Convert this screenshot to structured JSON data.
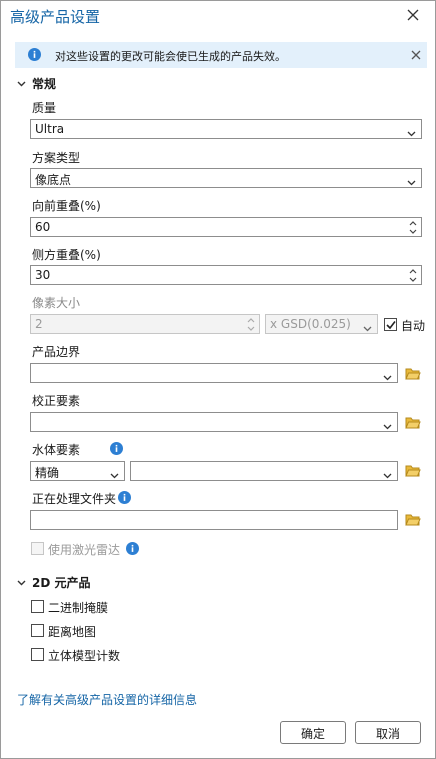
{
  "window": {
    "title": "高级产品设置"
  },
  "banner": {
    "message": "对这些设置的更改可能会使已生成的产品失效。"
  },
  "general": {
    "header": "常规",
    "quality": {
      "label": "质量",
      "value": "Ultra"
    },
    "scenario_type": {
      "label": "方案类型",
      "value": "像底点"
    },
    "forward_overlap": {
      "label": "向前重叠(%)",
      "value": "60"
    },
    "side_overlap": {
      "label": "侧方重叠(%)",
      "value": "30"
    },
    "pixel_size": {
      "label": "像素大小",
      "value": "2",
      "unit": "x GSD(0.025)",
      "auto_label": "自动",
      "auto_checked": true
    },
    "product_boundary": {
      "label": "产品边界",
      "value": ""
    },
    "correction_features": {
      "label": "校正要素",
      "value": ""
    },
    "water_features": {
      "label": "水体要素",
      "mode": "精确",
      "value": ""
    },
    "processing_folder": {
      "label": "正在处理文件夹",
      "value": ""
    },
    "use_lidar": {
      "label": "使用激光雷达",
      "checked": false,
      "enabled": false
    }
  },
  "products2d": {
    "header": "2D 元产品",
    "items": [
      {
        "label": "二进制掩膜",
        "checked": false
      },
      {
        "label": "距离地图",
        "checked": false
      },
      {
        "label": "立体模型计数",
        "checked": false
      }
    ]
  },
  "footer": {
    "learn_more": "了解有关高级产品设置的详细信息",
    "ok_label": "确定",
    "cancel_label": "取消"
  },
  "colors": {
    "accent": "#1565a6",
    "banner_bg": "#e3f0fb",
    "info_icon": "#2d7fd3",
    "folder": "#d8a526"
  }
}
